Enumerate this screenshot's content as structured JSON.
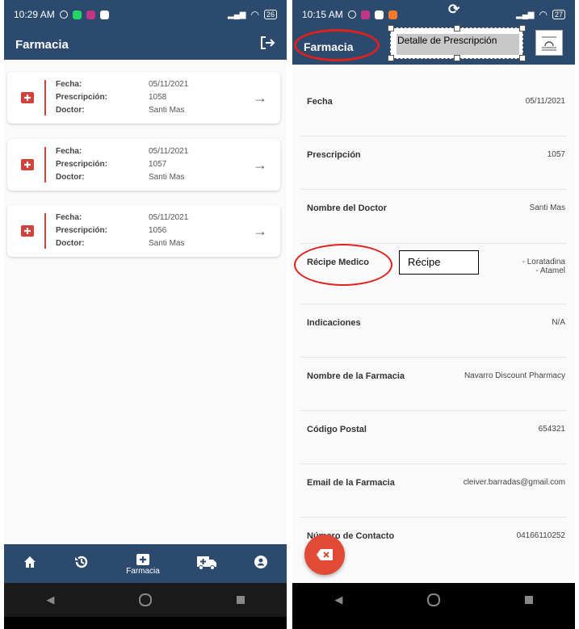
{
  "left": {
    "status": {
      "time": "10:29 AM",
      "battery": "26"
    },
    "appbar": {
      "title": "Farmacia"
    },
    "cards": [
      {
        "fecha_label": "Fecha:",
        "fecha": "05/11/2021",
        "presc_label": "Prescripción:",
        "presc": "1058",
        "doctor_label": "Doctor:",
        "doctor": "Santi Mas"
      },
      {
        "fecha_label": "Fecha:",
        "fecha": "05/11/2021",
        "presc_label": "Prescripción:",
        "presc": "1057",
        "doctor_label": "Doctor:",
        "doctor": "Santi Mas"
      },
      {
        "fecha_label": "Fecha:",
        "fecha": "05/11/2021",
        "presc_label": "Prescripción:",
        "presc": "1056",
        "doctor_label": "Doctor:",
        "doctor": "Santi Mas"
      }
    ],
    "nav": {
      "farmacia_label": "Farmacia"
    }
  },
  "right": {
    "status": {
      "time": "10:15 AM",
      "battery": "27"
    },
    "appbar": {
      "title": "Farmacia"
    },
    "annotation": {
      "header_box": "Detalle de Prescripción",
      "recipe_box": "Récipe"
    },
    "details": {
      "fecha_label": "Fecha",
      "fecha": "05/11/2021",
      "presc_label": "Prescripción",
      "presc": "1057",
      "doctor_label": "Nombre del Doctor",
      "doctor": "Santi Mas",
      "recipe_label": "Récipe Medico",
      "recipe_1": "- Loratadina",
      "recipe_2": "- Atamel",
      "ind_label": "Indicaciones",
      "ind": "N/A",
      "farm_label": "Nombre de la Farmacia",
      "farm": "Navarro Discount Pharmacy",
      "cp_label": "Código Postal",
      "cp": "654321",
      "email_label": "Email de la Farmacia",
      "email": "cleiver.barradas@gmail.com",
      "contact_label": "Número de Contacto",
      "contact": "04166110252"
    }
  },
  "colors": {
    "primary": "#2c4a6e",
    "accent": "#d2413a",
    "annotation": "#e0201c"
  }
}
